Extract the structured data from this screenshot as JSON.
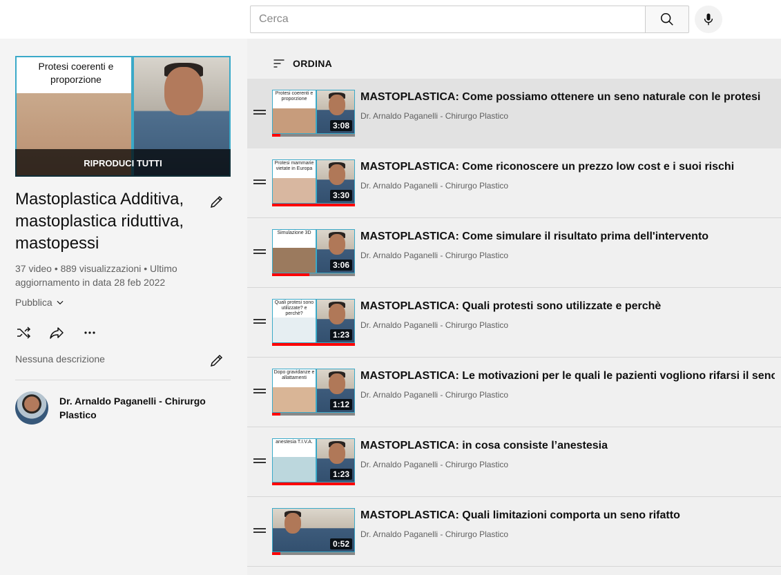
{
  "search": {
    "placeholder": "Cerca"
  },
  "playlist": {
    "play_all_label": "RIPRODUCI TUTTI",
    "hero_caption": "Protesi coerenti e proporzione",
    "title": "Mastoplastica Additiva, mastoplastica riduttiva, mastopessi",
    "stats": "37 video • 889 visualizzazioni • Ultimo aggiornamento in data 28 feb 2022",
    "privacy": "Pubblica",
    "description": "Nessuna descrizione",
    "owner": "Dr. Arnaldo Paganelli - Chirurgo Plastico"
  },
  "sort_label": "ORDINA",
  "colors": {
    "accent_red": "#ff0000",
    "frame_blue": "#3aa9c8"
  },
  "videos": [
    {
      "title": "MASTOPLASTICA: Come possiamo ottenere un seno naturale con le protesi",
      "channel": "Dr. Arnaldo Paganelli - Chirurgo Plastico",
      "duration": "3:08",
      "caption": "Protesi coerenti e proporzione",
      "progress": 0.1,
      "active": true
    },
    {
      "title": "MASTOPLASTICA: Come riconoscere un prezzo low cost e i suoi rischi",
      "channel": "Dr. Arnaldo Paganelli - Chirurgo Plastico",
      "duration": "3:30",
      "caption": "Protesi mammarie vietate in Europa",
      "progress": 1.0
    },
    {
      "title": "MASTOPLASTICA: Come simulare il risultato prima dell'intervento",
      "channel": "Dr. Arnaldo Paganelli - Chirurgo Plastico",
      "duration": "3:06",
      "caption": "Simulazione 3D",
      "progress": 0.45
    },
    {
      "title": "MASTOPLASTICA: Quali protesti sono utilizzate e perchè",
      "channel": "Dr. Arnaldo Paganelli - Chirurgo Plastico",
      "duration": "1:23",
      "caption": "Quali protesi sono utilizzate? e perchè?",
      "progress": 1.0
    },
    {
      "title": "MASTOPLASTICA: Le motivazioni per le quali le pazienti vogliono rifarsi il seno",
      "channel": "Dr. Arnaldo Paganelli - Chirurgo Plastico",
      "duration": "1:12",
      "caption": "Dopo gravidanze e allattamenti",
      "progress": 0.1
    },
    {
      "title": "MASTOPLASTICA: in cosa consiste l’anestesia",
      "channel": "Dr. Arnaldo Paganelli - Chirurgo Plastico",
      "duration": "1:23",
      "caption": "anestesia T.I.V.A.",
      "progress": 1.0
    },
    {
      "title": "MASTOPLASTICA: Quali limitazioni comporta un seno rifatto",
      "channel": "Dr. Arnaldo Paganelli - Chirurgo Plastico",
      "duration": "0:52",
      "caption": "",
      "progress": 0.1
    }
  ]
}
